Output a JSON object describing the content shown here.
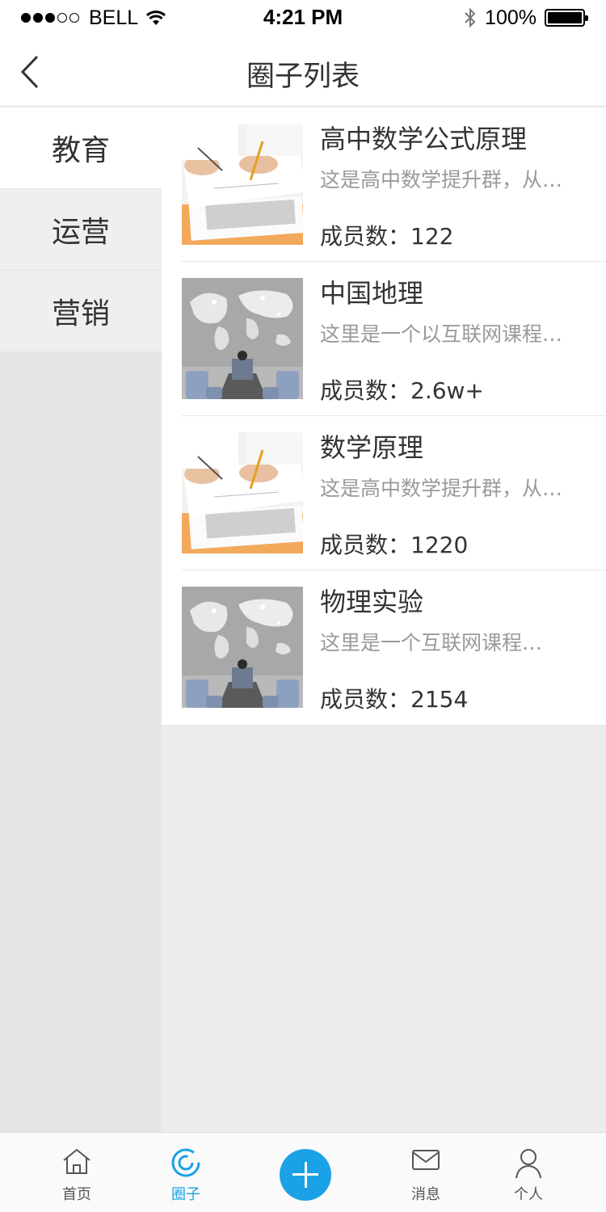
{
  "status_bar": {
    "carrier": "BELL",
    "time": "4:21 PM",
    "battery": "100%"
  },
  "nav": {
    "title": "圈子列表"
  },
  "sidebar": {
    "items": [
      {
        "label": "教育",
        "active": true
      },
      {
        "label": "运营",
        "active": false
      },
      {
        "label": "营销",
        "active": false
      }
    ]
  },
  "list": {
    "items": [
      {
        "title": "高中数学公式原理",
        "desc": "这是高中数学提升群，从…",
        "members": "成员数：122",
        "image": "document-signing-photo"
      },
      {
        "title": "中国地理",
        "desc": "这里是一个以互联网课程…",
        "members": "成员数：2.6w+",
        "image": "world-map-meeting-photo"
      },
      {
        "title": "数学原理",
        "desc": "这是高中数学提升群，从…",
        "members": "成员数：1220",
        "image": "document-signing-photo"
      },
      {
        "title": "物理实验",
        "desc": "这里是一个互联网课程…",
        "members": "成员数：2154",
        "image": "world-map-meeting-photo"
      }
    ]
  },
  "tab_bar": {
    "home": "首页",
    "circle": "圈子",
    "messages": "消息",
    "profile": "个人",
    "active_color": "#1aa1e6"
  }
}
